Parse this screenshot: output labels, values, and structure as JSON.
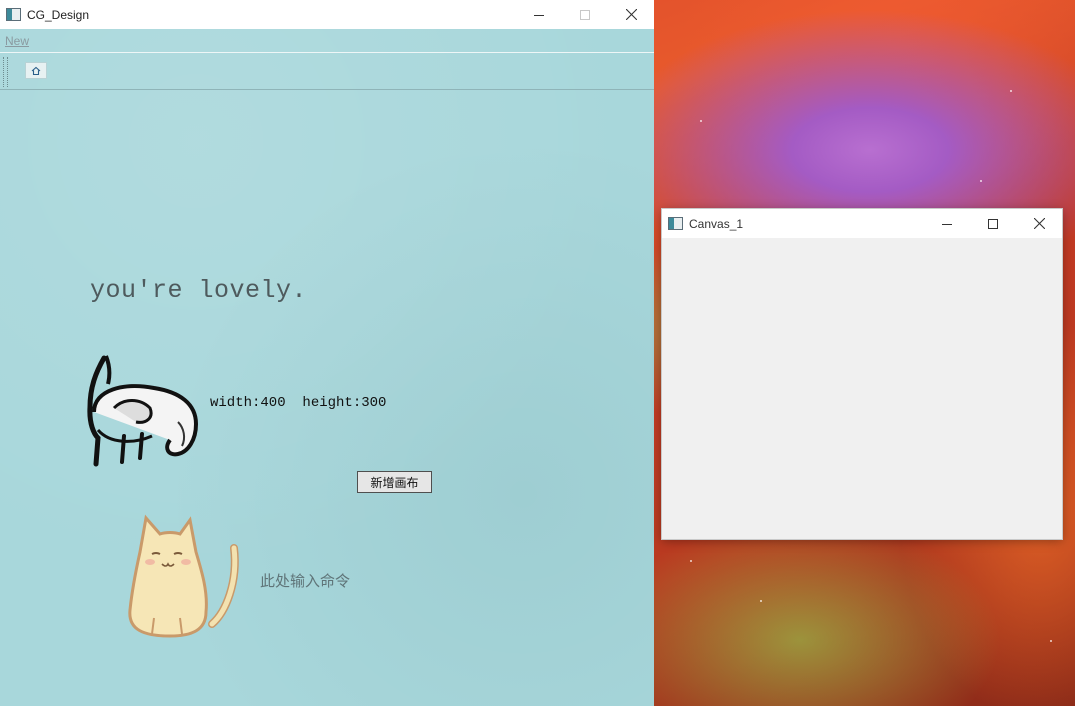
{
  "main_window": {
    "title": "CG_Design",
    "menu": {
      "new_label": "New"
    },
    "toolbar": {
      "home_icon": "home-icon"
    },
    "content": {
      "banner_text": "you're lovely.",
      "size_label": "width:400  height:300",
      "new_canvas_button": "新增画布",
      "command_placeholder": "此处输入命令"
    }
  },
  "canvas_window": {
    "title": "Canvas_1"
  },
  "colors": {
    "main_background": "#a8d7db",
    "canvas_background": "#f0f0f0",
    "desktop_accent": "#d8402a"
  }
}
